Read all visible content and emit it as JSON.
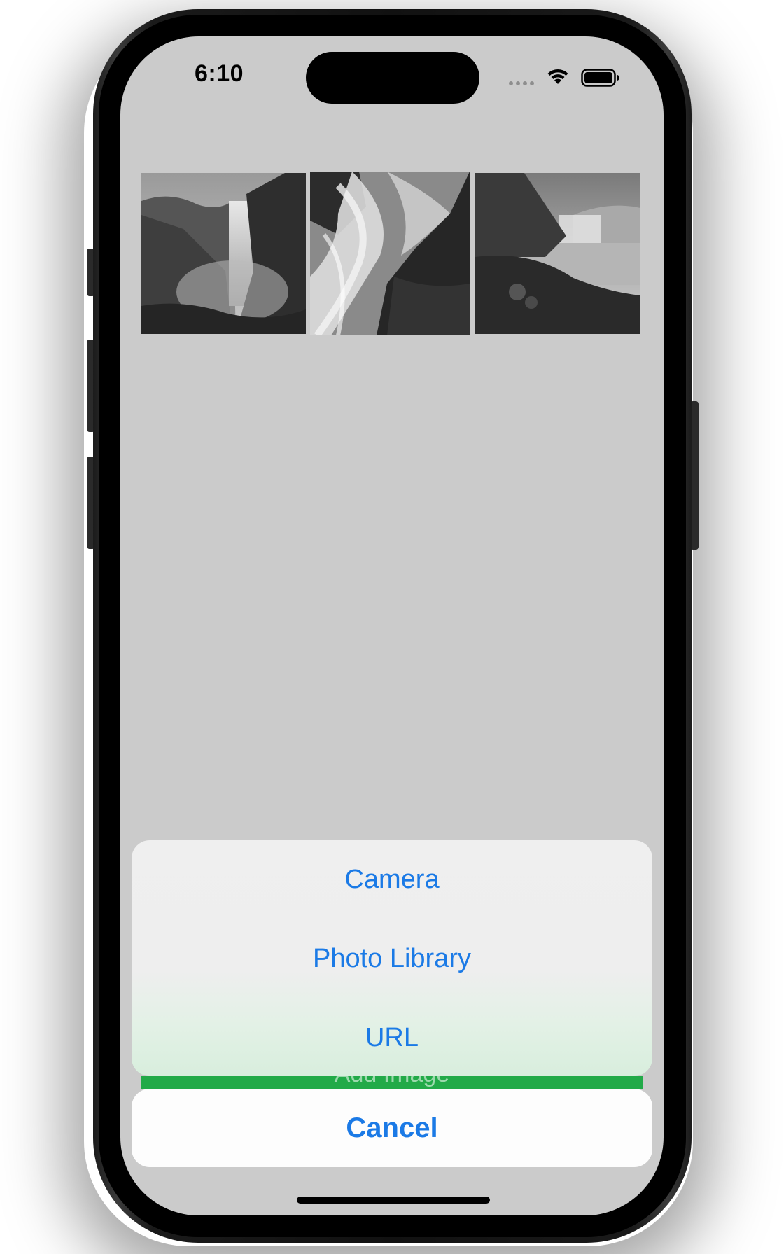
{
  "status_bar": {
    "time": "6:10",
    "signal_icon": "cellular-signal-icon",
    "wifi_icon": "wifi-icon",
    "battery_icon": "battery-icon"
  },
  "gallery": {
    "images": [
      {
        "name": "waterfall-photo-1",
        "description_icon": "image"
      },
      {
        "name": "waterfall-photo-2",
        "description_icon": "image"
      },
      {
        "name": "waterfall-photo-3",
        "description_icon": "image"
      }
    ]
  },
  "action_sheet": {
    "options": [
      {
        "label": "Camera"
      },
      {
        "label": "Photo Library"
      },
      {
        "label": "URL"
      }
    ],
    "cancel_label": "Cancel"
  },
  "background_button": {
    "label": "Add Image",
    "color": "#22aa48"
  },
  "colors": {
    "accent": "#1b7ae6",
    "screen_background": "#cbcbcb"
  }
}
